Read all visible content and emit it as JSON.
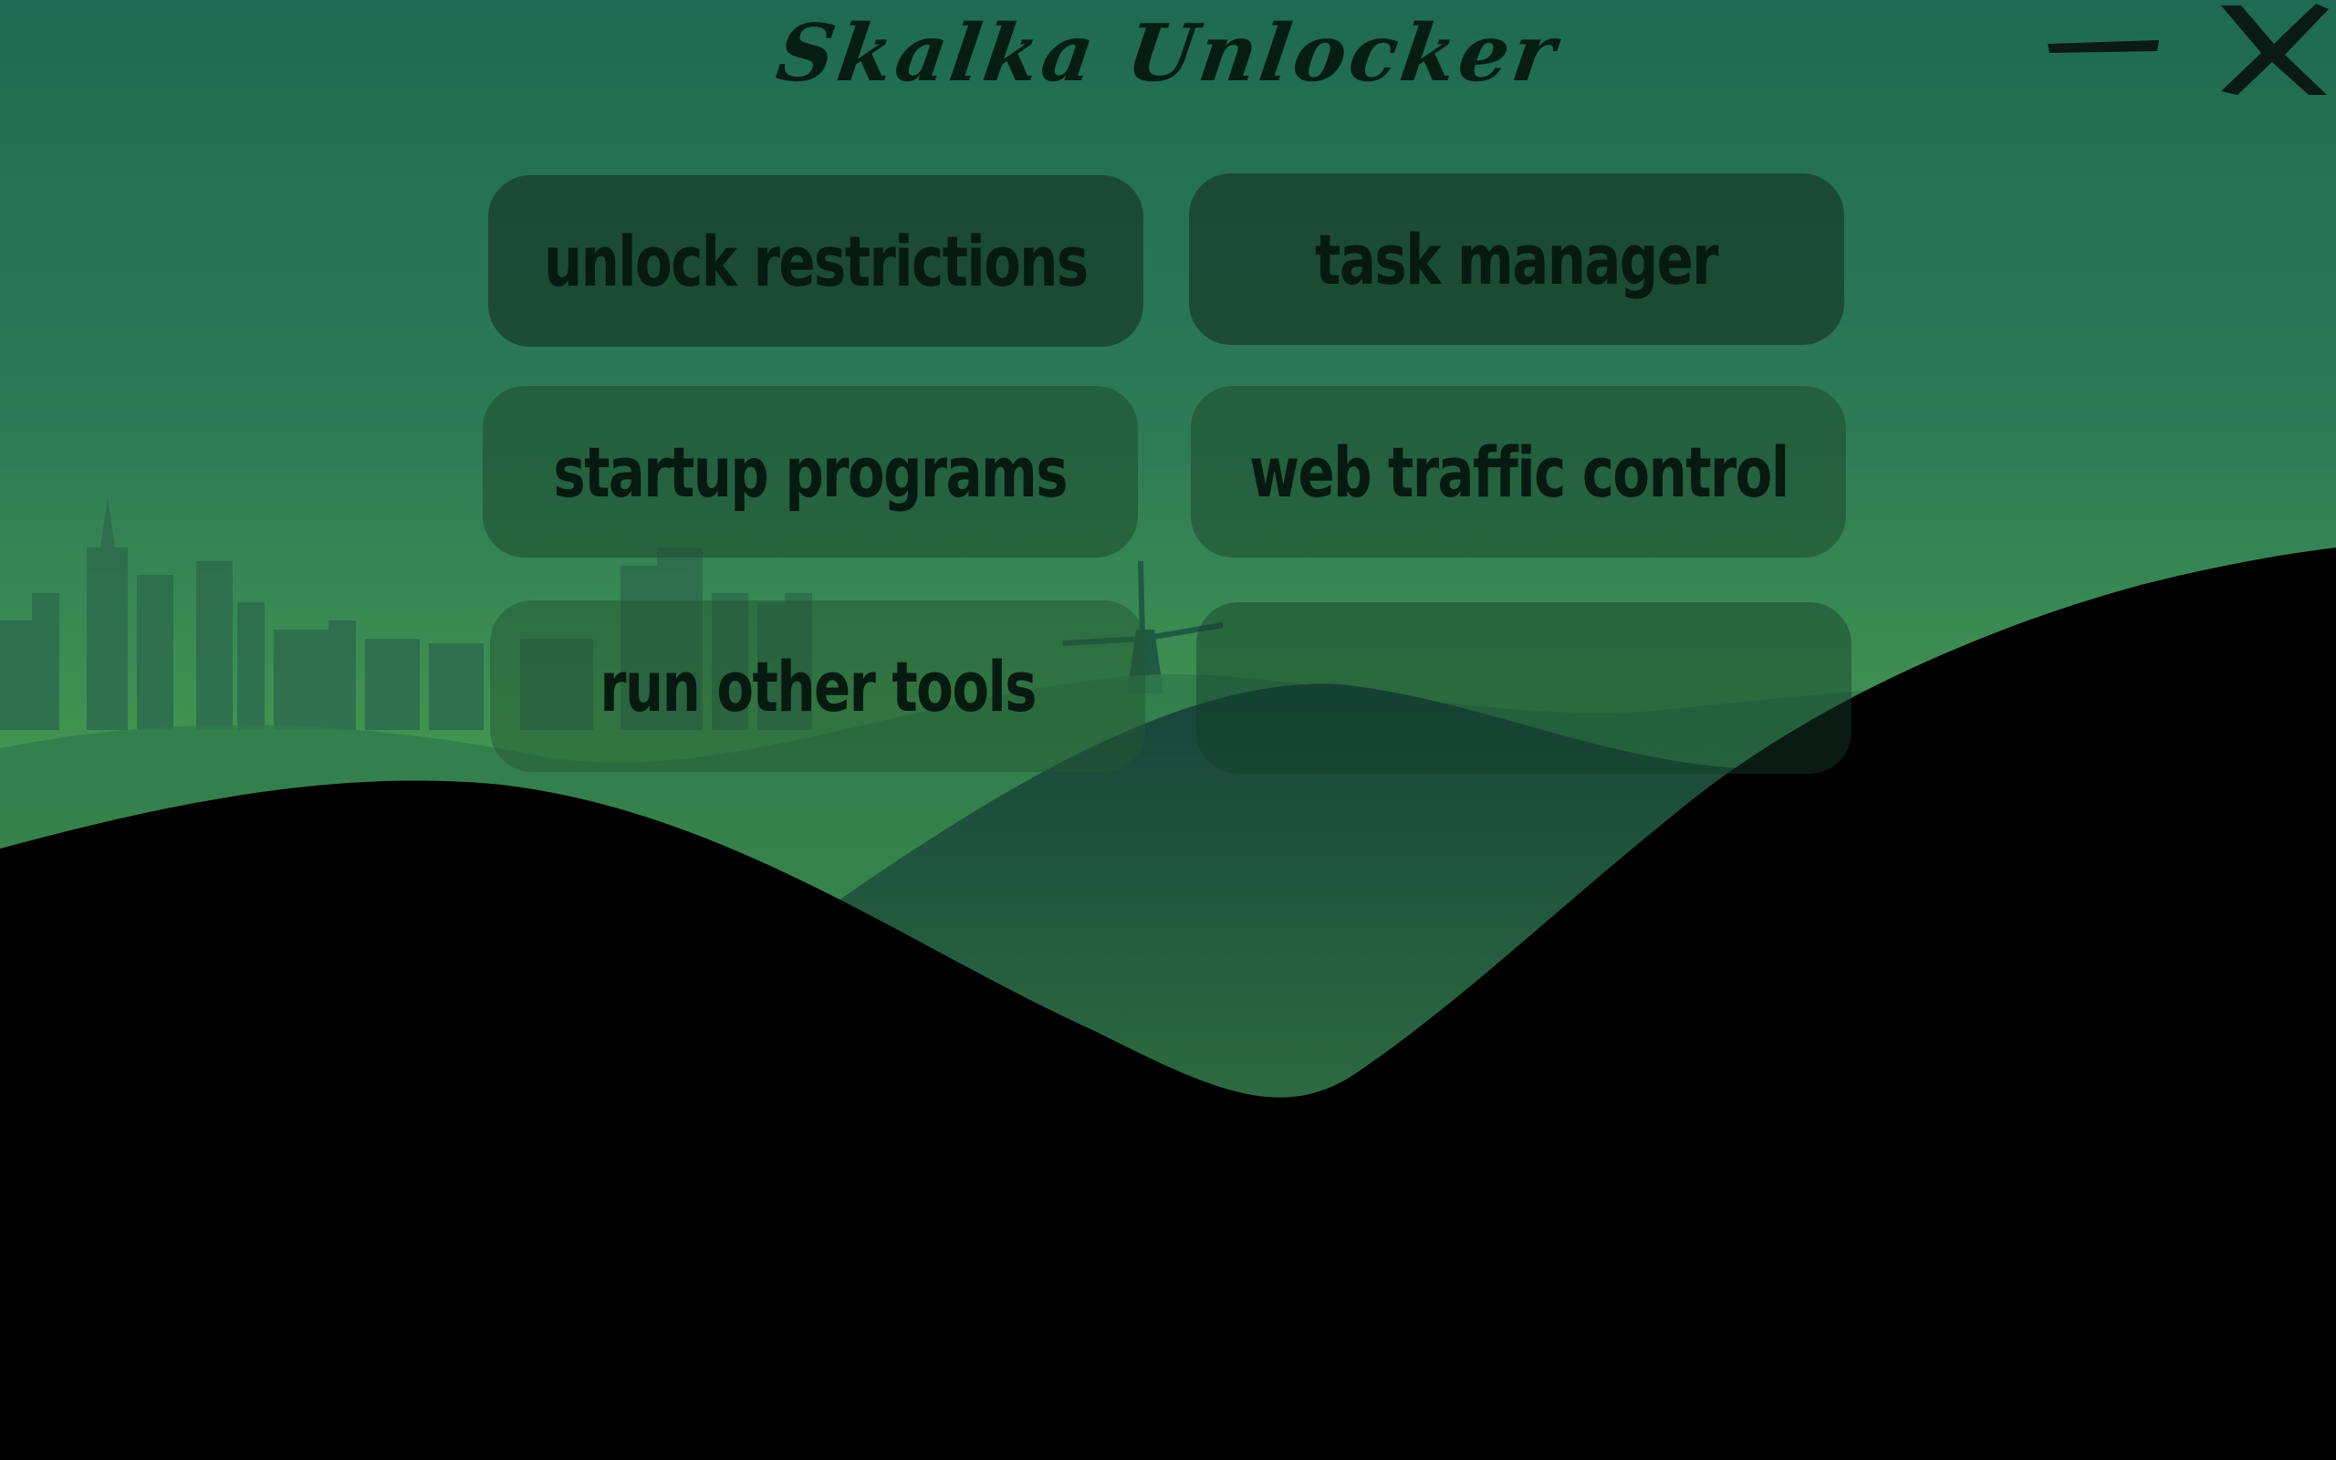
{
  "window": {
    "title": "Skalka Unlocker",
    "minimize_icon": "minimize-icon",
    "close_icon": "close-icon"
  },
  "menu": {
    "buttons": [
      {
        "label": "unlock restrictions"
      },
      {
        "label": "task manager"
      },
      {
        "label": "startup programs"
      },
      {
        "label": "web traffic control"
      },
      {
        "label": "run other tools"
      },
      {
        "label": ""
      }
    ]
  },
  "colors": {
    "sky_top": "#1e6a52",
    "sky_bottom": "#66b84a",
    "ground": "#000000",
    "text": "#061a10"
  }
}
